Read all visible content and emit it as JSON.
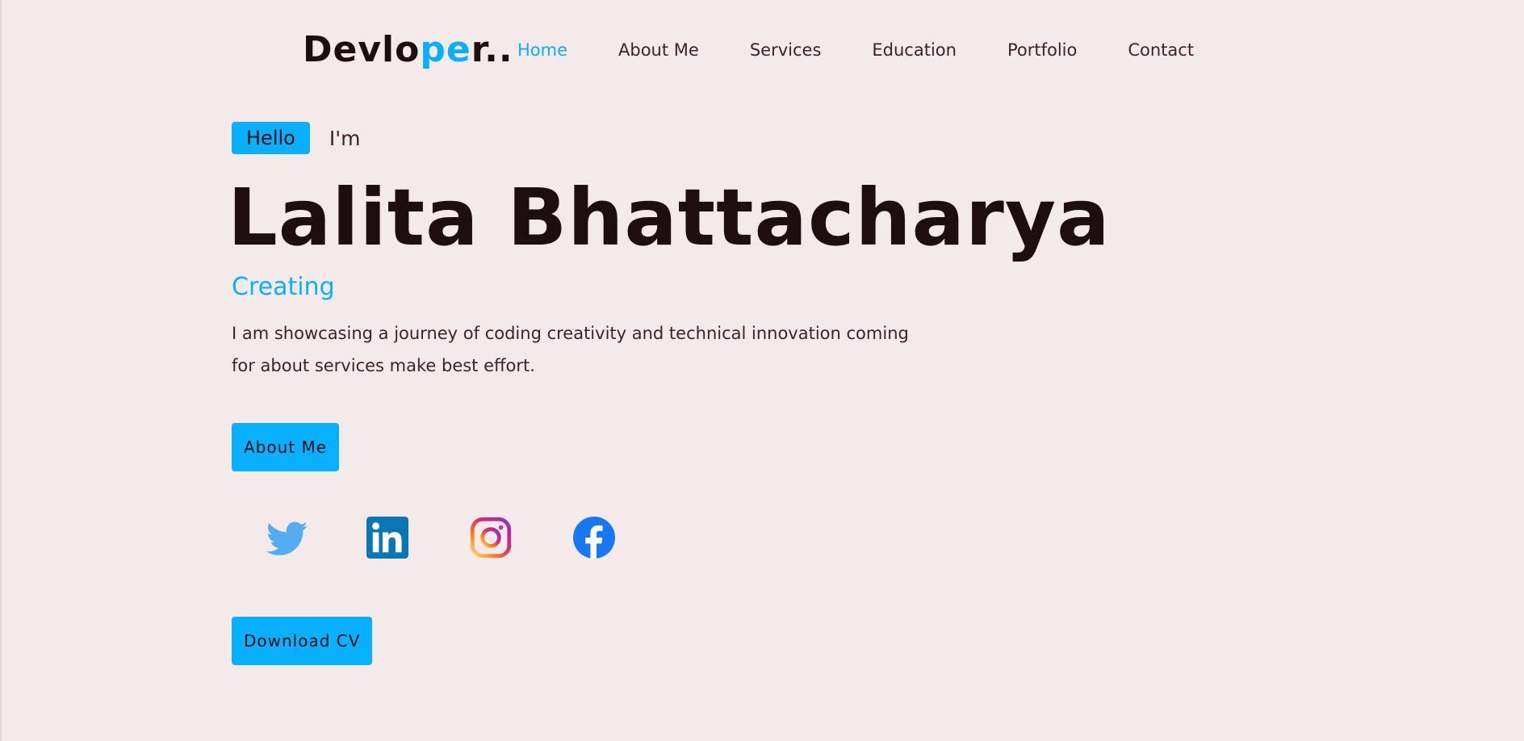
{
  "nav": {
    "logo": {
      "part1": "Devlo",
      "part2": "pe",
      "part3": "r.."
    },
    "links": [
      "Home",
      "About Me",
      "Services",
      "Education",
      "Portfolio",
      "Contact"
    ],
    "active": "Home"
  },
  "hero": {
    "hello": "Hello",
    "im": "I'm",
    "name": "Lalita Bhattacharya",
    "role": "Creating",
    "description": "I am showcasing a journey of coding creativity and technical innovation coming for about services make best effort.",
    "about_button": "About Me",
    "cv_button": "Download CV"
  },
  "socials": [
    {
      "icon": "twitter-icon",
      "color": "#55acee"
    },
    {
      "icon": "linkedin-icon",
      "color": "#0a77b5"
    },
    {
      "icon": "instagram-icon",
      "color": "#d62976"
    },
    {
      "icon": "facebook-icon",
      "color": "#1877f2"
    }
  ],
  "colors": {
    "accent": "#09b0ff",
    "background": "#f5eaea",
    "text_dark": "#1e0e10",
    "text_muted": "#3d2328"
  }
}
